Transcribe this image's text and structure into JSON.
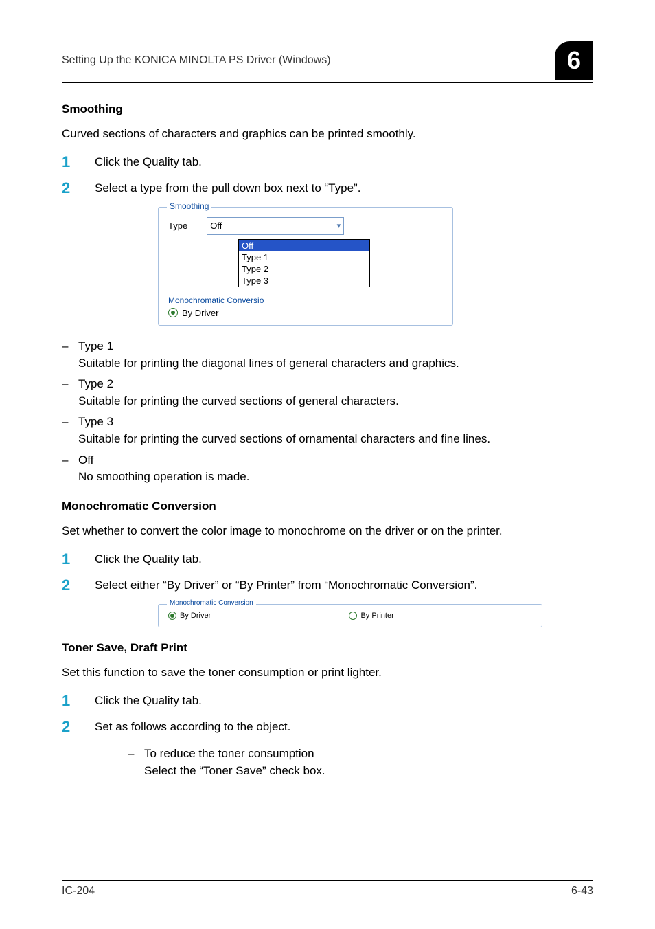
{
  "header": {
    "running_title": "Setting Up the KONICA MINOLTA PS Driver (Windows)",
    "chapter_number": "6"
  },
  "sec1": {
    "heading": "Smoothing",
    "intro": "Curved sections of characters and graphics can be printed smoothly.",
    "step1": "Click the Quality tab.",
    "step2": "Select a type from the pull down box next to “Type”.",
    "shot": {
      "group_legend": "Smoothing",
      "type_label": "Type",
      "combo_value": "Off",
      "options": {
        "o0": "Off",
        "o1": "Type 1",
        "o2": "Type 2",
        "o3": "Type 3"
      },
      "mono_legend": "Monochromatic Conversio",
      "radio_label": "By Driver"
    },
    "types": {
      "t1_name": "Type 1",
      "t1_desc": "Suitable for printing the diagonal lines of general characters and graphics.",
      "t2_name": "Type 2",
      "t2_desc": "Suitable for printing the curved sections of general characters.",
      "t3_name": "Type 3",
      "t3_desc": "Suitable for printing the curved sections of ornamental characters and fine lines.",
      "off_name": "Off",
      "off_desc": "No smoothing operation is made."
    }
  },
  "sec2": {
    "heading": "Monochromatic Conversion",
    "intro": "Set whether to convert the color image to monochrome on the driver or on the printer.",
    "step1": "Click the Quality tab.",
    "step2": "Select either “By Driver” or “By Printer” from “Monochromatic Conversion”.",
    "shot": {
      "group_legend": "Monochromatic Conversion",
      "opt1": "By Driver",
      "opt2": "By Printer"
    }
  },
  "sec3": {
    "heading": "Toner Save, Draft Print",
    "intro": "Set this function to save the toner consumption or print lighter.",
    "step1": "Click the Quality tab.",
    "step2": "Set as follows according to the object.",
    "bullet1_line1": "To reduce the toner consumption",
    "bullet1_line2": "Select the “Toner Save” check box."
  },
  "footer": {
    "left": "IC-204",
    "right": "6-43"
  }
}
